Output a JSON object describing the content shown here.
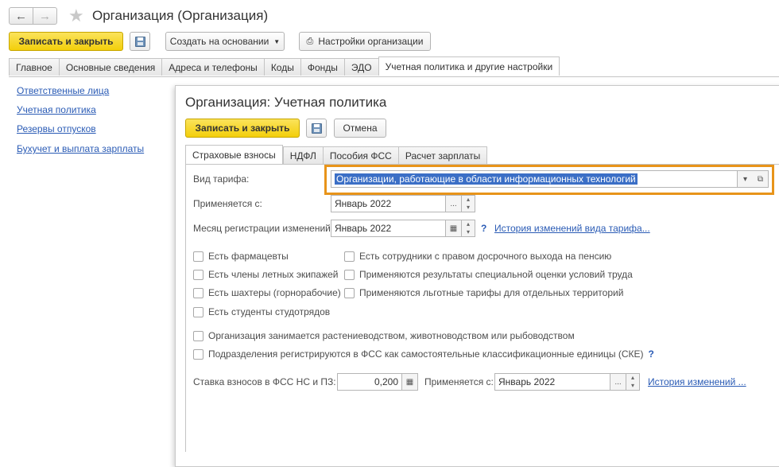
{
  "window": {
    "title": "Организация (Организация)",
    "buttons": {
      "save_close": "Записать и закрыть",
      "create_based": "Создать на основании",
      "org_settings": "Настройки организации"
    },
    "tabs": [
      "Главное",
      "Основные сведения",
      "Адреса и телефоны",
      "Коды",
      "Фонды",
      "ЭДО",
      "Учетная политика и другие настройки"
    ]
  },
  "sidebar": {
    "links": [
      "Ответственные лица",
      "Учетная политика",
      "Резервы отпусков",
      "Бухучет и выплата зарплаты"
    ]
  },
  "dialog": {
    "title": "Организация: Учетная политика",
    "save_close": "Записать и закрыть",
    "cancel": "Отмена",
    "tabs": [
      "Страховые взносы",
      "НДФЛ",
      "Пособия ФСС",
      "Расчет зарплаты"
    ],
    "fields": {
      "tariff_label": "Вид тарифа:",
      "tariff_value": "Организации, работающие в области информационных технологий",
      "applies_label": "Применяется с:",
      "applies_value": "Январь 2022",
      "month_label": "Месяц регистрации изменений:",
      "month_value": "Январь 2022",
      "history_tariff_link": "История изменений вида тарифа..."
    },
    "checkboxes_left": [
      "Есть фармацевты",
      "Есть члены летных экипажей",
      "Есть шахтеры (горнорабочие)",
      "Есть студенты студотрядов"
    ],
    "checkboxes_right": [
      "Есть сотрудники с правом досрочного выхода на пенсию",
      "Применяются результаты специальной оценки условий труда",
      "Применяются льготные тарифы для отдельных территорий"
    ],
    "checkbox_agri": "Организация занимается растениеводством, животноводством или рыбоводством",
    "checkbox_fss": "Подразделения регистрируются в ФСС как самостоятельные классификационные единицы (СКЕ)",
    "rate": {
      "label": "Ставка взносов в ФСС НС и ПЗ:",
      "value": "0,200",
      "applies_label": "Применяется с:",
      "applies_value": "Январь 2022",
      "history_link": "История изменений ..."
    },
    "help": "?",
    "ellipsis": "...",
    "colors": {
      "highlight_border": "#e8941a",
      "selection_bg": "#3b6fc6",
      "primary_button": "#f5d21f"
    }
  }
}
